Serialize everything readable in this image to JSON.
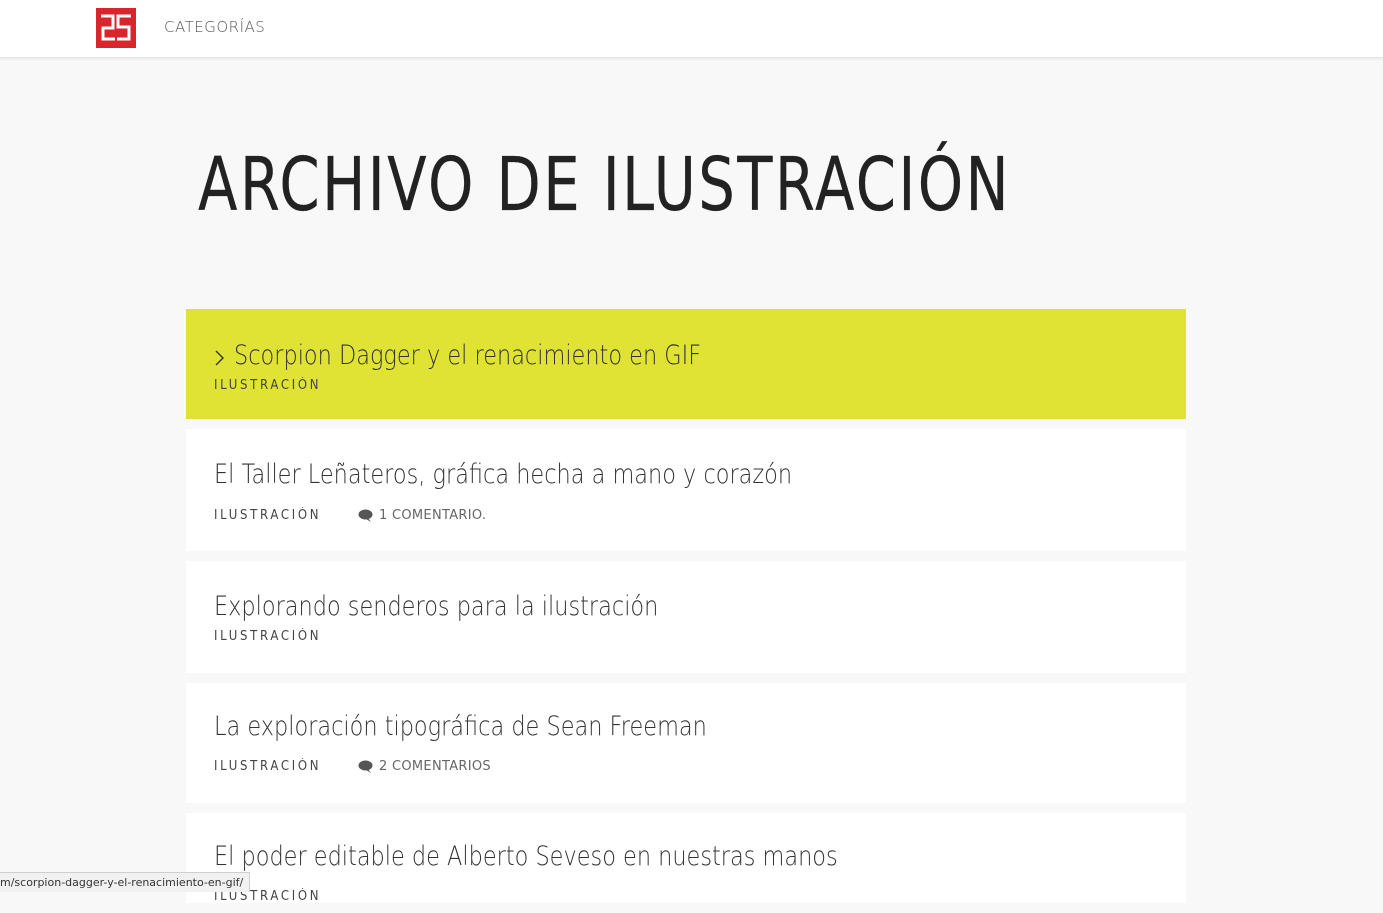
{
  "brand": {
    "logo_text": "25",
    "logo_color": "#d9262c"
  },
  "nav": {
    "categories_label": "CATEGORÍAS"
  },
  "page": {
    "title": "ARCHIVO DE ILUSTRACIÓN"
  },
  "accent_color": "#e0e234",
  "posts": [
    {
      "title": "Scorpion Dagger y el renacimiento en GIF",
      "category": "ILUSTRACIÓN",
      "comments": ""
    },
    {
      "title": "El Taller Leñateros, gráfica hecha a mano y corazón",
      "category": "ILUSTRACIÓN",
      "comments": "1 COMENTARIO."
    },
    {
      "title": "Explorando senderos para la ilustración",
      "category": "ILUSTRACIÓN",
      "comments": ""
    },
    {
      "title": "La exploración tipográfica de Sean Freeman",
      "category": "ILUSTRACIÓN",
      "comments": "2 COMENTARIOS"
    },
    {
      "title": "El poder editable de Alberto Seveso en nuestras manos",
      "category": "ILUSTRACIÓN",
      "comments": ""
    }
  ],
  "status": {
    "url": "m/scorpion-dagger-y-el-renacimiento-en-gif/"
  }
}
